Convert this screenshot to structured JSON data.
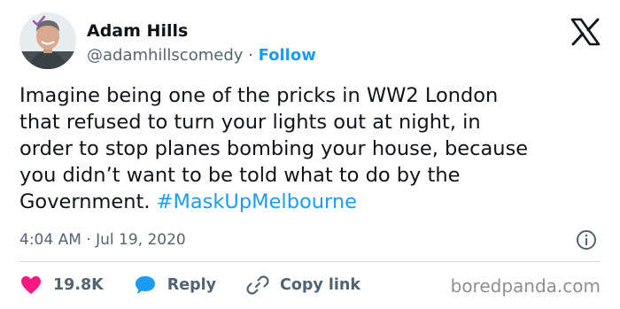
{
  "author": {
    "display_name": "Adam Hills",
    "handle": "@adamhillscomedy",
    "separator": " · ",
    "follow_label": "Follow",
    "verified_color": "#9b59b6"
  },
  "tweet": {
    "lines": [
      "Imagine being one of the pricks in WW2 London",
      "that refused to turn your lights out at night, in",
      "order to stop planes bombing your house, because",
      "you didn’t want to be told what to do by the"
    ],
    "last_line_text": "Government. ",
    "hashtag": "#MaskUpMelbourne",
    "timestamp": "4:04 AM · Jul 19, 2020"
  },
  "actions": {
    "like_count": "19.8K",
    "reply_label": "Reply",
    "copy_link_label": "Copy link"
  },
  "icons": {
    "logo": "x-logo-icon",
    "info": "info-icon",
    "like": "heart-icon",
    "reply": "reply-bubble-icon",
    "copy_link": "link-icon"
  },
  "colors": {
    "accent": "#1d9bf0",
    "like": "#f91880",
    "secondary_text": "#536471"
  },
  "watermark": "boredpanda.com"
}
